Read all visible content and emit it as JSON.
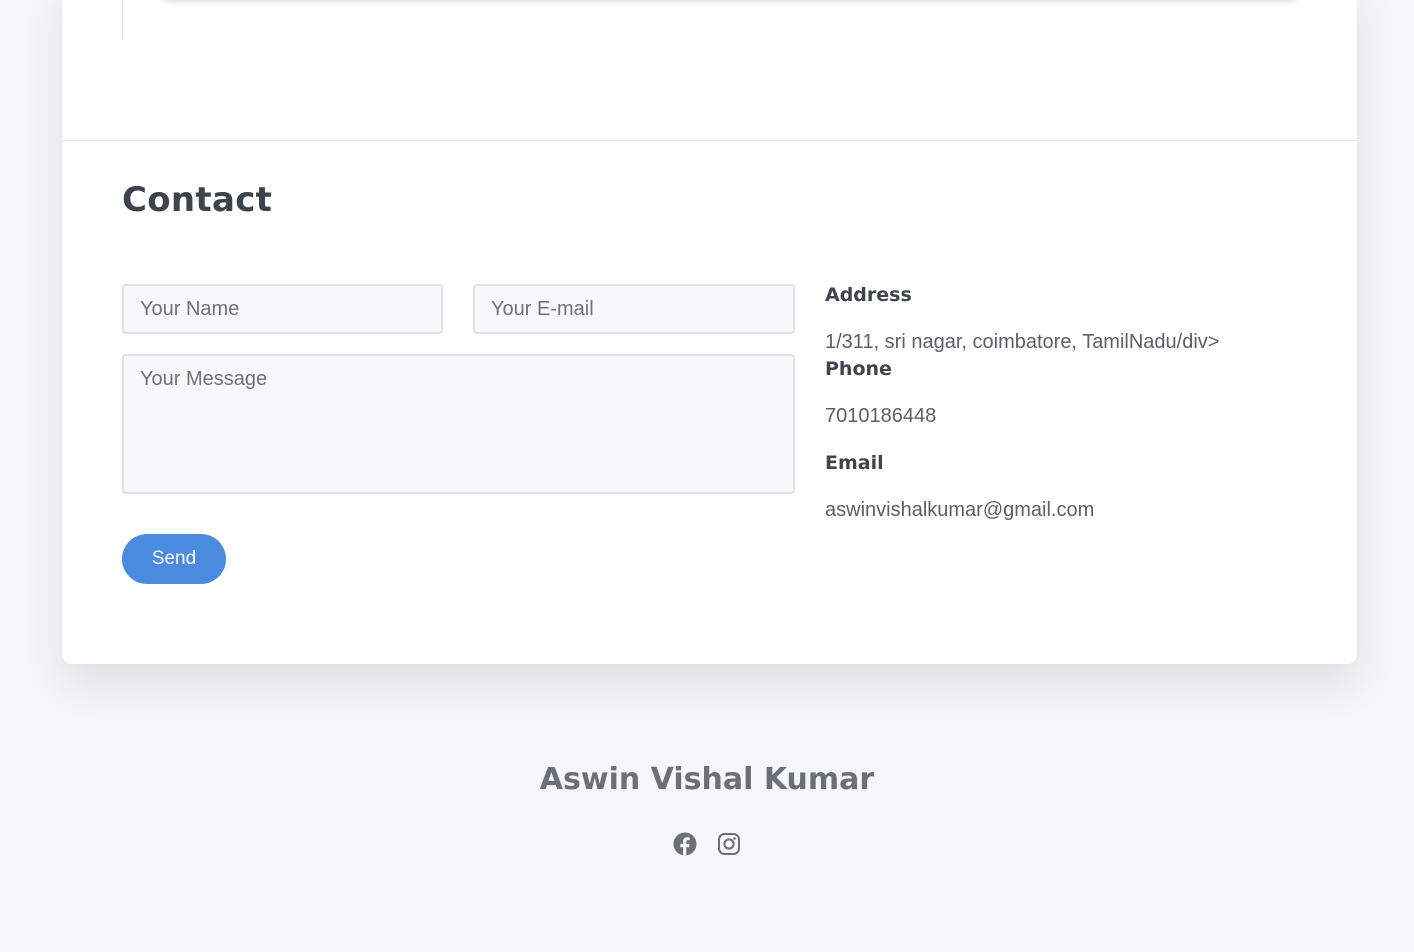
{
  "contact": {
    "title": "Contact",
    "form": {
      "name_placeholder": "Your Name",
      "email_placeholder": "Your E-mail",
      "message_placeholder": "Your Message",
      "send_label": "Send"
    },
    "info": {
      "address_label": "Address",
      "address_value": "1/311, sri nagar, coimbatore, TamilNadu/div>",
      "phone_label": "Phone",
      "phone_value": "7010186448",
      "email_label": "Email",
      "email_value": "aswinvishalkumar@gmail.com"
    }
  },
  "footer": {
    "name": "Aswin Vishal Kumar",
    "social": [
      {
        "icon": "facebook-icon"
      },
      {
        "icon": "instagram-icon"
      }
    ]
  },
  "colors": {
    "page_background": "#f5f6f9",
    "card_background": "#ffffff",
    "accent": "#4a8adf",
    "heading": "#3d434b",
    "muted": "#6b7078"
  }
}
